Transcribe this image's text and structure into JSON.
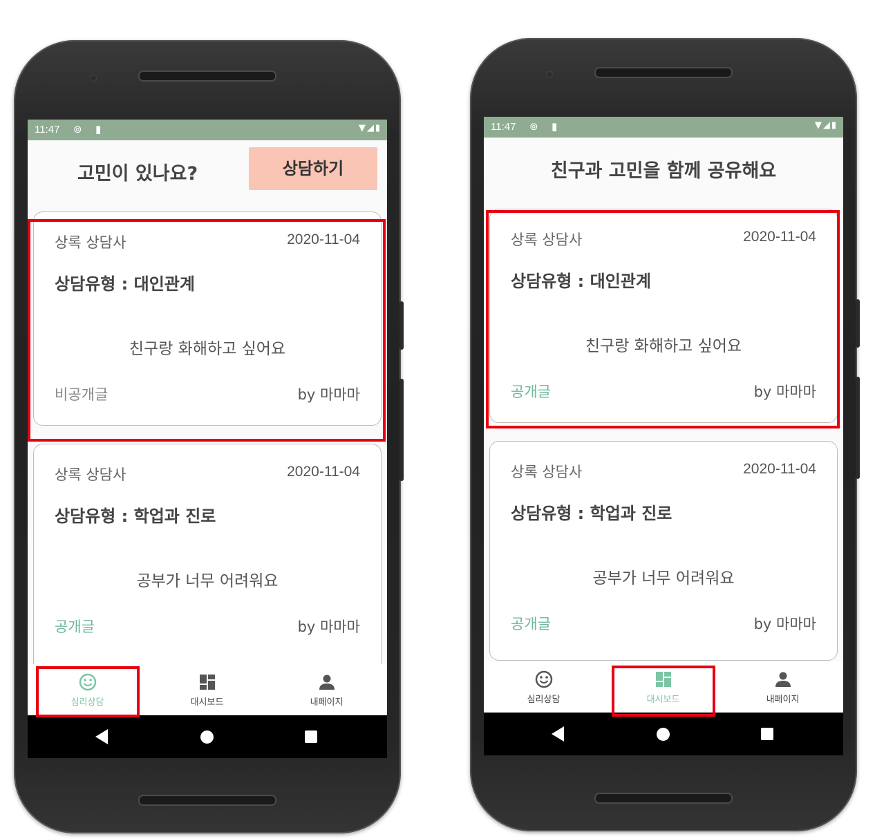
{
  "left": {
    "status": {
      "time": "11:47"
    },
    "header": {
      "title": "고민이 있나요?",
      "consult_button": "상담하기"
    },
    "cards": [
      {
        "counselor": "상록 상담사",
        "date": "2020-11-04",
        "type": "상담유형 : 대인관계",
        "content": "친구랑 화해하고 싶어요",
        "visibility": "비공개글",
        "author": "by 마마마",
        "highlighted": true
      },
      {
        "counselor": "상록 상담사",
        "date": "2020-11-04",
        "type": "상담유형 : 학업과 진로",
        "content": "공부가 너무 어려워요",
        "visibility": "공개글",
        "author": "by 마마마",
        "highlighted": false
      }
    ],
    "nav": [
      {
        "label": "심리상담",
        "icon": "smiley-icon",
        "active": true
      },
      {
        "label": "대시보드",
        "icon": "dashboard-icon",
        "active": false
      },
      {
        "label": "내페이지",
        "icon": "person-icon",
        "active": false
      }
    ]
  },
  "right": {
    "status": {
      "time": "11:47"
    },
    "header": {
      "title": "친구과 고민을 함께 공유해요"
    },
    "cards": [
      {
        "counselor": "상록 상담사",
        "date": "2020-11-04",
        "type": "상담유형 : 대인관계",
        "content": "친구랑 화해하고 싶어요",
        "visibility": "공개글",
        "author": "by 마마마",
        "highlighted": true
      },
      {
        "counselor": "상록 상담사",
        "date": "2020-11-04",
        "type": "상담유형 : 학업과 진로",
        "content": "공부가 너무 어려워요",
        "visibility": "공개글",
        "author": "by 마마마",
        "highlighted": false
      }
    ],
    "nav": [
      {
        "label": "심리상담",
        "icon": "smiley-icon",
        "active": false
      },
      {
        "label": "대시보드",
        "icon": "dashboard-icon",
        "active": true
      },
      {
        "label": "내페이지",
        "icon": "person-icon",
        "active": false
      }
    ]
  },
  "colors": {
    "status_bar": "#8fac93",
    "accent": "#7cc4a4",
    "button": "#fac5b5",
    "highlight": "#e60012"
  }
}
